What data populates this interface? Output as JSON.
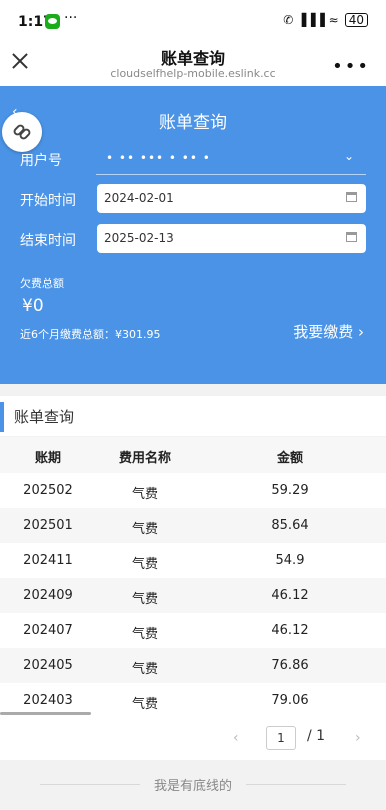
{
  "status": {
    "time": "1:17",
    "battery": "40",
    "icons_right": "✆ ▐▐▐ ≈"
  },
  "window": {
    "title": "账单查询",
    "domain": "cloudselfhelp-mobile.eslink.cc"
  },
  "form": {
    "heading": "账单查询",
    "user_label": "用户号",
    "user_value_masked": "• ••  ••• • •• •",
    "start_label": "开始时间",
    "start_value": "2024-02-01",
    "end_label": "结束时间",
    "end_value": "2025-02-13",
    "arrears_label": "欠费总额",
    "arrears_value": "¥0",
    "six_month_text": "近6个月缴费总额：¥301.95",
    "pay_button": "我要缴费"
  },
  "table": {
    "section_title": "账单查询",
    "headers": [
      "账期",
      "费用名称",
      "金额"
    ],
    "rows": [
      [
        "202502",
        "气费",
        "59.29"
      ],
      [
        "202501",
        "气费",
        "85.64"
      ],
      [
        "202411",
        "气费",
        "54.9"
      ],
      [
        "202409",
        "气费",
        "46.12"
      ],
      [
        "202407",
        "气费",
        "46.12"
      ],
      [
        "202405",
        "气费",
        "76.86"
      ],
      [
        "202403",
        "气费",
        "79.06"
      ]
    ]
  },
  "pager": {
    "current": "1",
    "separator_total": "/ 1"
  },
  "footer": {
    "text": "我是有底线的"
  },
  "colors": {
    "primary": "#4a93e6"
  }
}
